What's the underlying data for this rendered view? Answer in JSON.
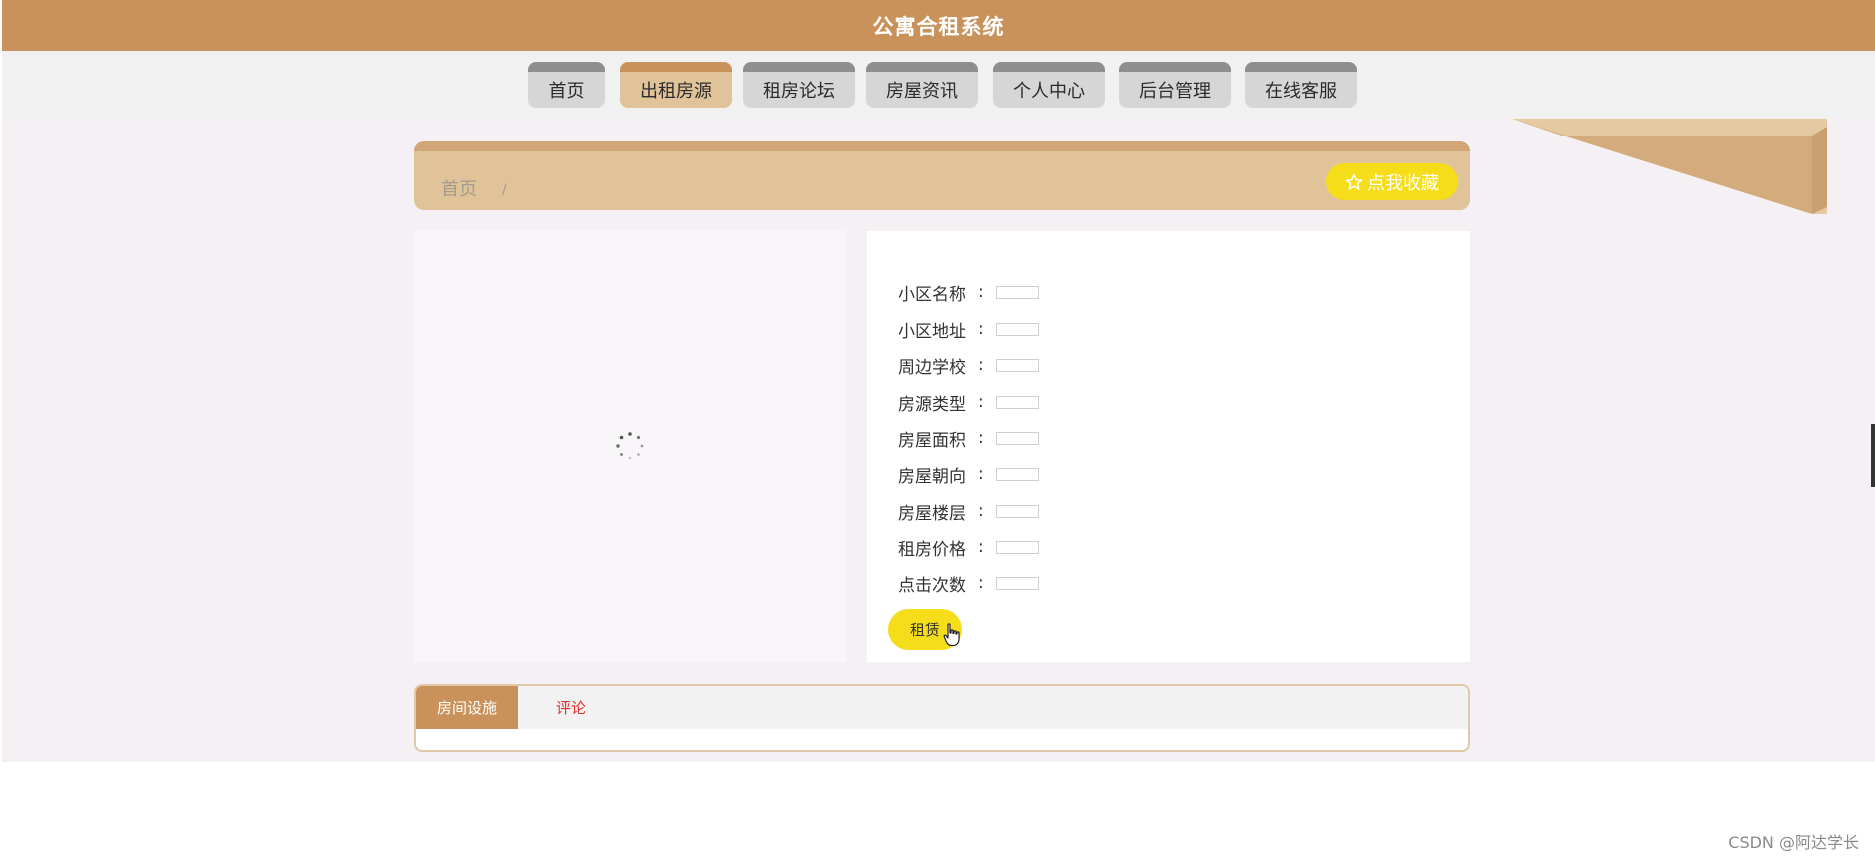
{
  "header": {
    "title": "公寓合租系统"
  },
  "nav": {
    "items": [
      {
        "label": "首页"
      },
      {
        "label": "出租房源",
        "active": true
      },
      {
        "label": "租房论坛"
      },
      {
        "label": "房屋资讯"
      },
      {
        "label": "个人中心"
      },
      {
        "label": "后台管理"
      },
      {
        "label": "在线客服"
      }
    ]
  },
  "breadcrumb": {
    "home": "首页",
    "separator": "/"
  },
  "favorite": {
    "label": "点我收藏",
    "icon": "star-icon"
  },
  "details": {
    "fields": [
      {
        "label": "小区名称",
        "value": ""
      },
      {
        "label": "小区地址",
        "value": ""
      },
      {
        "label": "周边学校",
        "value": ""
      },
      {
        "label": "房源类型",
        "value": ""
      },
      {
        "label": "房屋面积",
        "value": ""
      },
      {
        "label": "房屋朝向",
        "value": ""
      },
      {
        "label": "房屋楼层",
        "value": ""
      },
      {
        "label": "租房价格",
        "value": ""
      },
      {
        "label": "点击次数",
        "value": ""
      }
    ],
    "colon": ":",
    "rent_label": "租赁"
  },
  "tabs": {
    "facilities": "房间设施",
    "comments": "评论"
  },
  "watermark": "CSDN @阿达学长",
  "colors": {
    "header": "#c9925a",
    "nav_active": "#e0c398",
    "accent_yellow": "#f5dd1a",
    "comment_tab": "#e0302a"
  }
}
